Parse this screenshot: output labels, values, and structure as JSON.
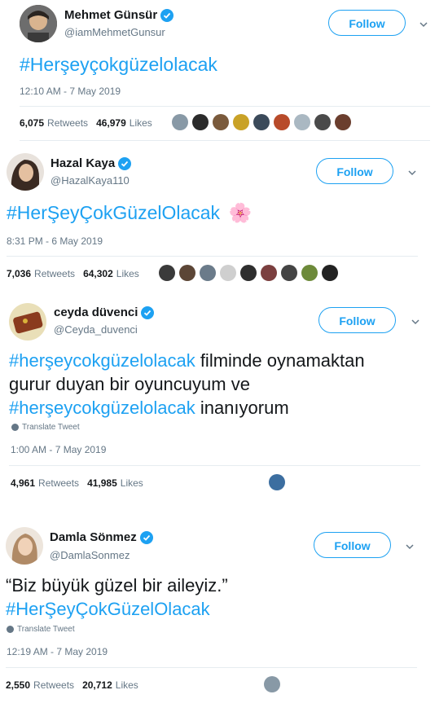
{
  "tweets": [
    {
      "name": "Mehmet Günsür",
      "handle": "@iamMehmetGunsur",
      "follow": "Follow",
      "text_plain": "",
      "hashtag": "#Herşeyçokgüzelolacak",
      "timestamp": "12:10 AM - 7 May 2019",
      "retweets": "6,075",
      "likes": "46,979",
      "retweets_label": "Retweets",
      "likes_label": "Likes",
      "faces": [
        "#8899a6",
        "#2b2b2b",
        "#7a5a3c",
        "#c9a227",
        "#3b4a5a",
        "#b84b2a",
        "#aab8c2",
        "#4a4a4a",
        "#6b3e2e"
      ]
    },
    {
      "name": "Hazal Kaya",
      "handle": "@HazalKaya110",
      "follow": "Follow",
      "hashtag": "#HerŞeyÇokGüzelOlacak",
      "emoji": "🌸",
      "timestamp": "8:31 PM - 6 May 2019",
      "retweets": "7,036",
      "likes": "64,302",
      "retweets_label": "Retweets",
      "likes_label": "Likes",
      "faces": [
        "#3a3a3a",
        "#5c4636",
        "#6b7b8a",
        "#cfcfcf",
        "#2e2e2e",
        "#7b3f3f",
        "#444",
        "#6d8a3a",
        "#222"
      ]
    },
    {
      "name": "ceyda düvenci",
      "handle": "@Ceyda_duvenci",
      "follow": "Follow",
      "line1_tag": "#herşeycokgüzelolacak",
      "line1_rest": " filminde oynamaktan",
      "line2": "gurur duyan bir oyuncuyum ve",
      "line3_tag": "#herşeycokgüzelolacak",
      "line3_rest": " inanıyorum",
      "translate": "Translate Tweet",
      "timestamp": "1:00 AM - 7 May 2019",
      "retweets": "4,961",
      "likes": "41,985",
      "retweets_label": "Retweets",
      "likes_label": "Likes",
      "faces": [
        "#3c6ea0"
      ]
    },
    {
      "name": "Damla Sönmez",
      "handle": "@DamlaSonmez",
      "follow": "Follow",
      "line1": "“Biz büyük güzel bir aileyiz.”",
      "line2_tag": "#HerŞeyÇokGüzelOlacak",
      "translate": "Translate Tweet",
      "timestamp": "12:19 AM - 7 May 2019",
      "retweets": "2,550",
      "likes": "20,712",
      "retweets_label": "Retweets",
      "likes_label": "Likes",
      "faces": [
        "#8899a6"
      ]
    }
  ],
  "colors": {
    "accent": "#1da1f2",
    "text": "#14171a",
    "muted": "#657786",
    "divider": "#e6ecf0"
  }
}
